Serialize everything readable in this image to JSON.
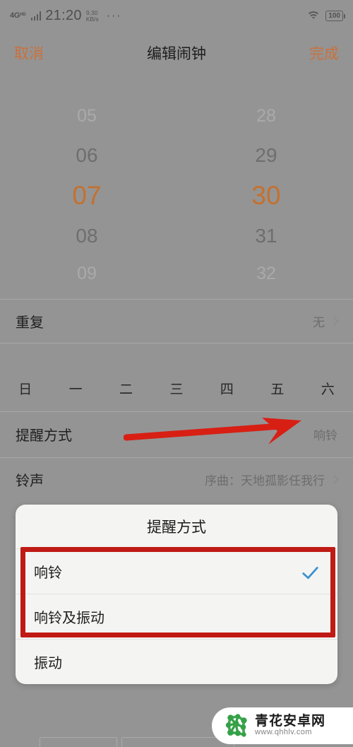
{
  "statusbar": {
    "network_type": "4G",
    "network_sub": "HD",
    "clock": "21:20",
    "speed_value": "9.30",
    "speed_unit": "KB/s",
    "overflow": "···",
    "wifi_icon": "wifi-icon",
    "battery": "100"
  },
  "appbar": {
    "cancel": "取消",
    "title": "编辑闹钟",
    "done": "完成",
    "accent": "#c9713c"
  },
  "picker": {
    "hours": [
      "05",
      "06",
      "07",
      "08",
      "09"
    ],
    "minutes": [
      "28",
      "29",
      "30",
      "31",
      "32"
    ],
    "selected_hour": "07",
    "selected_minute": "30",
    "selected_color": "#c4712f"
  },
  "rows": {
    "repeat": {
      "label": "重复",
      "value": "无",
      "chevron": "chevron-right-icon"
    },
    "weekdays": [
      "日",
      "一",
      "二",
      "三",
      "四",
      "五",
      "六"
    ],
    "reminder": {
      "label": "提醒方式",
      "value": "响铃"
    },
    "ringtone": {
      "label": "铃声",
      "value": "序曲：天地孤影任我行",
      "chevron": "chevron-right-icon"
    }
  },
  "dialog": {
    "title": "提醒方式",
    "options": [
      {
        "label": "响铃",
        "selected": true
      },
      {
        "label": "响铃及振动",
        "selected": false
      },
      {
        "label": "振动",
        "selected": false
      }
    ],
    "check_color": "#3e92cf"
  },
  "annotations": {
    "arrow_color": "#d81f14",
    "box_color": "#c01a14",
    "arrow_name": "red-arrow-annotation",
    "box_name": "red-box-annotation"
  },
  "watermark": {
    "site_name": "青花安卓网",
    "url": "www.qhhlv.com",
    "logo_color": "#35a148"
  }
}
